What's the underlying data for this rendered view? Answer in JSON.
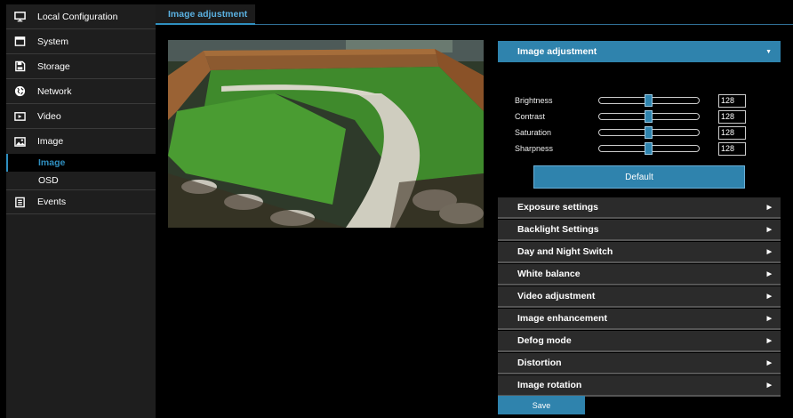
{
  "sidebar": {
    "items": [
      {
        "label": "Local Configuration",
        "icon": "monitor-icon"
      },
      {
        "label": "System",
        "icon": "system-icon"
      },
      {
        "label": "Storage",
        "icon": "storage-icon"
      },
      {
        "label": "Network",
        "icon": "globe-icon"
      },
      {
        "label": "Video",
        "icon": "video-icon"
      },
      {
        "label": "Image",
        "icon": "image-icon"
      }
    ],
    "sub_items": [
      {
        "label": "Image",
        "active": true
      },
      {
        "label": "OSD",
        "active": false
      }
    ],
    "events": {
      "label": "Events",
      "icon": "events-icon"
    }
  },
  "header": {
    "tab_label": "Image adjustment"
  },
  "panel": {
    "open_section": "Image adjustment",
    "sliders": [
      {
        "label": "Brightness",
        "value": "128"
      },
      {
        "label": "Contrast",
        "value": "128"
      },
      {
        "label": "Saturation",
        "value": "128"
      },
      {
        "label": "Sharpness",
        "value": "128"
      }
    ],
    "slider_max": 255,
    "default_label": "Default",
    "sections": [
      "Exposure settings",
      "Backlight Settings",
      "Day and Night Switch",
      "White balance",
      "Video adjustment",
      "Image enhancement",
      "Defog mode",
      "Distortion",
      "Image rotation"
    ]
  },
  "save_label": "Save",
  "colors": {
    "accent": "#2f83ad",
    "active_text": "#2f8fc0",
    "sidebar_bg": "#1e1e1e"
  }
}
